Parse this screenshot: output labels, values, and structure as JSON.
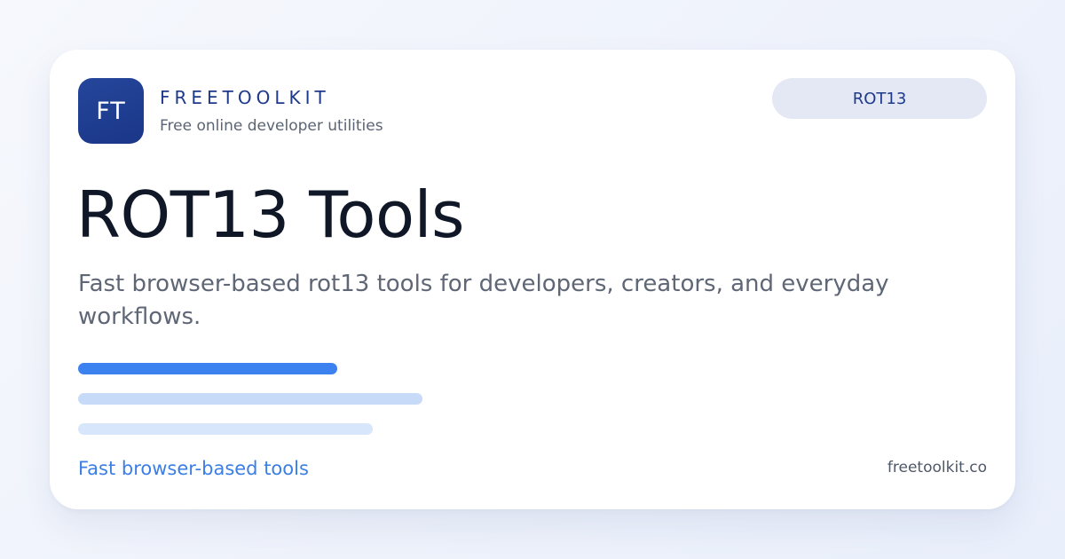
{
  "brand": {
    "logo_text": "FT",
    "name": "FREETOOLKIT",
    "tagline": "Free online developer utilities"
  },
  "tag": {
    "label": "ROT13"
  },
  "hero": {
    "title": "ROT13 Tools",
    "description": "Fast browser-based rot13 tools for developers, creators, and everyday workflows."
  },
  "footer": {
    "left_text": "Fast browser-based tools",
    "right_text": "freetoolkit.co"
  },
  "colors": {
    "logo_bg": "#1f3a8a",
    "accent": "#3b82f0",
    "bar_light": "#c7daf8",
    "bar_lighter": "#d8e6fb",
    "pill_bg": "#e3e8f4",
    "title": "#101828"
  }
}
